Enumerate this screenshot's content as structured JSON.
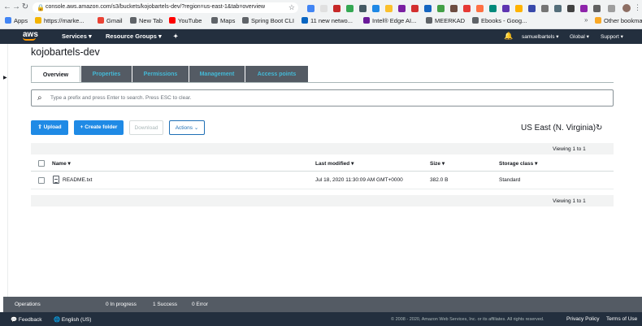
{
  "browser": {
    "url": "console.aws.amazon.com/s3/buckets/kojobartels-dev/?region=us-east-1&tab=overview",
    "bookmarks": [
      {
        "label": "Apps",
        "color": "#4285f4"
      },
      {
        "label": "https://marke...",
        "color": "#f4b400"
      },
      {
        "label": "Gmail",
        "color": "#ea4335"
      },
      {
        "label": "New Tab",
        "color": "#5f6368"
      },
      {
        "label": "YouTube",
        "color": "#ff0000"
      },
      {
        "label": "Maps",
        "color": "#5f6368"
      },
      {
        "label": "Spring Boot CLI",
        "color": "#5f6368"
      },
      {
        "label": "11 new netwo...",
        "color": "#0a66c2"
      },
      {
        "label": "Intel® Edge AI...",
        "color": "#6a1b9a"
      },
      {
        "label": "MEERKAD",
        "color": "#5f6368"
      },
      {
        "label": "Ebooks - Goog...",
        "color": "#5f6368"
      }
    ],
    "other_bookmarks": "Other bookmarks",
    "more_bookmarks": "»"
  },
  "aws_nav": {
    "logo": "aws",
    "services": "Services",
    "resource_groups": "Resource Groups",
    "user": "samuelbartels",
    "region_menu": "Global",
    "support": "Support"
  },
  "bucket": {
    "title": "kojobartels-dev",
    "tabs": [
      "Overview",
      "Properties",
      "Permissions",
      "Management",
      "Access points"
    ],
    "search_placeholder": "Type a prefix and press Enter to search. Press ESC to clear.",
    "buttons": {
      "upload": "Upload",
      "create_folder": "Create folder",
      "download": "Download",
      "actions": "Actions"
    },
    "region": "US East (N. Virginia)",
    "viewing_top": "Viewing 1 to 1",
    "viewing_bottom": "Viewing 1 to 1",
    "columns": {
      "name": "Name",
      "last_modified": "Last modified",
      "size": "Size",
      "storage_class": "Storage class"
    },
    "rows": [
      {
        "name": "README.txt",
        "last_modified": "Jul 18, 2020 11:30:09 AM GMT+0000",
        "size": "382.0 B",
        "storage_class": "Standard"
      }
    ]
  },
  "status": {
    "operations": "Operations",
    "in_progress": "0 In progress",
    "success": "1 Success",
    "error": "0 Error"
  },
  "footer": {
    "feedback": "Feedback",
    "language": "English (US)",
    "copyright": "© 2008 - 2020, Amazon Web Services, Inc. or its affiliates. All rights reserved.",
    "privacy": "Privacy Policy",
    "terms": "Terms of Use"
  },
  "colors": {
    "aws_nav_bg": "#232f3e",
    "aws_orange": "#ff9900",
    "primary_button": "#1f8ae5",
    "tab_bg": "#545b64",
    "tab_text": "#44b9d6"
  }
}
